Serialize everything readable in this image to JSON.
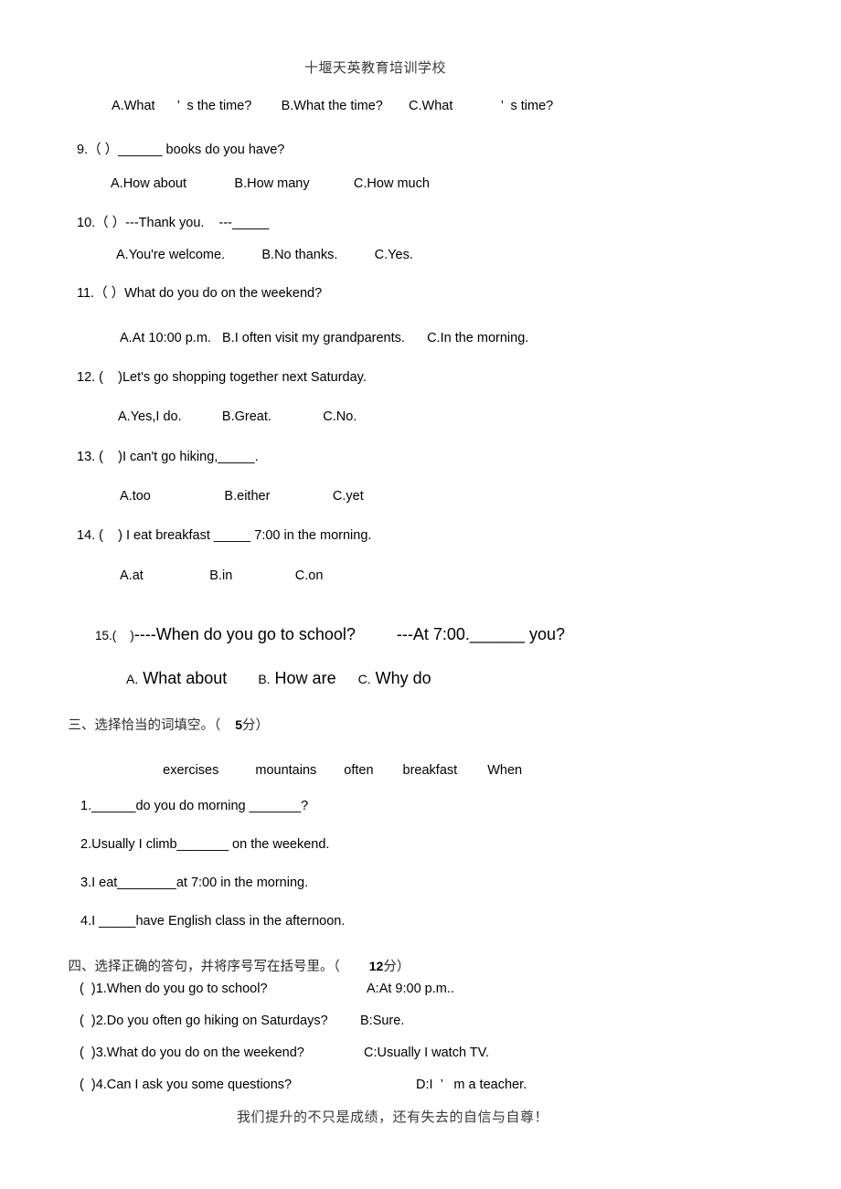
{
  "document": {
    "header": "十堰天英教育培训学校",
    "footer": "我们提升的不只是成绩，还有失去的自信与自尊！"
  },
  "questions": [
    {
      "id": "q8-options",
      "options": "A.What      ’  s the time?        B.What the time?       C.What             ’  s time?"
    },
    {
      "id": "q9",
      "stem": "9.（ ）______ books do you have?",
      "options": "A.How about             B.How many            C.How much"
    },
    {
      "id": "q10",
      "stem": "10.（ ）---Thank you.    ---_____",
      "options": "A.You're welcome.          B.No thanks.          C.Yes."
    },
    {
      "id": "q11",
      "stem": "11.（ ）What do you do on the weekend?",
      "options": "A.At 10:00 p.m.   B.I often visit my grandparents.      C.In the morning."
    },
    {
      "id": "q12",
      "stem": "12. (    )Let's go shopping together next Saturday.",
      "options": "A.Yes,I do.           B.Great.              C.No."
    },
    {
      "id": "q13",
      "stem": "13. (    )I can't go hiking,_____.",
      "options": "A.too                    B.either                 C.yet"
    },
    {
      "id": "q14",
      "stem": "14. (    ) I eat breakfast _____ 7:00 in the morning.",
      "options": "A.at                  B.in                 C.on"
    },
    {
      "id": "q15",
      "number": "15.(    )",
      "stem": "----When do you go to school?         ---At 7:00.______ you?",
      "option_a_letter": "A.",
      "option_a_text": " What about",
      "option_b_letter": "B.",
      "option_b_text": " How are",
      "option_c_letter": "C.",
      "option_c_text": " Why do"
    }
  ],
  "section_three": {
    "heading_prefix": "三、选择恰当的词填空。（",
    "score": "5",
    "heading_suffix": "分）",
    "word_bank": [
      "exercises",
      "mountains",
      "often",
      "breakfast",
      "When"
    ],
    "items": [
      "1.______do you do morning _______?",
      "2.Usually I climb_______ on the weekend.",
      "3.I eat________at 7:00 in the morning.",
      "4.I _____have English class in the afternoon."
    ]
  },
  "section_four": {
    "heading_prefix": "四、选择正确的答句，并将序号写在括号里。（",
    "score": "12",
    "heading_suffix": "分）",
    "questions": [
      "(  )1.When do you go to school?",
      "(  )2.Do you often go hiking on Saturdays?",
      "(  )3.What do you do on the weekend?",
      "(  )4.Can I ask you some questions?"
    ],
    "answers": [
      "A:At 9:00 p.m..",
      "B:Sure.",
      "C:Usually I watch TV.",
      "D:I  ’   m a teacher."
    ]
  }
}
